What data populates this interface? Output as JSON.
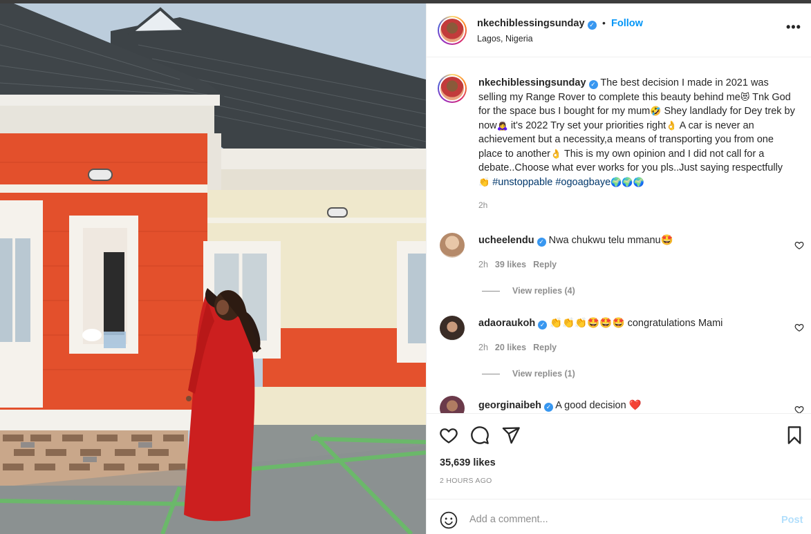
{
  "post": {
    "username": "nkechiblessingsunday",
    "verified_mark": "✓",
    "separator": "•",
    "follow_label": "Follow",
    "location": "Lagos, Nigeria",
    "more_label": "•••"
  },
  "caption": {
    "username": "nkechiblessingsunday",
    "text_1": "The best decision I made in 2021 was selling my Range Rover to complete this beauty behind me",
    "emoji_1": "😻",
    "text_2": " Tnk God for the space bus I bought for my mum",
    "emoji_2": "🤣",
    "text_3": " Shey landlady for Dey trek by now",
    "emoji_3": "🙇‍♀️",
    "text_4": " it's 2022 Try set your priorities right",
    "emoji_4": "👌",
    "text_5": " A car is never an achievement but a necessity,a means of transporting you from one place to another",
    "emoji_5": "👌",
    "text_6": " This is my own opinion and I did not call for a debate..Choose what ever works for you pls..Just saying respectfully ",
    "emoji_6": "👏",
    "hashtag_1": "#unstoppable",
    "hashtag_2": "#ogoagbaye",
    "emoji_7": "🌍🌍🌍",
    "time": "2h"
  },
  "comments": [
    {
      "username": "ucheelendu",
      "text": "Nwa chukwu telu mmanu🤩",
      "time": "2h",
      "likes": "39 likes",
      "reply_label": "Reply",
      "view_replies": "View replies (4)",
      "avatar_color": "#b58a6a"
    },
    {
      "username": "adaoraukoh",
      "text": "👏👏👏🤩🤩🤩 congratulations Mami",
      "time": "2h",
      "likes": "20 likes",
      "reply_label": "Reply",
      "view_replies": "View replies (1)",
      "avatar_color": "#3a2c26"
    },
    {
      "username": "georginaibeh",
      "text": "A good decision ❤️",
      "avatar_color": "#6b3a4a"
    }
  ],
  "actions": {
    "likes": "35,639 likes",
    "time_ago": "2 HOURS AGO"
  },
  "add_comment": {
    "placeholder": "Add a comment...",
    "post_label": "Post"
  },
  "colors": {
    "link": "#0095f6",
    "hashtag": "#00376b",
    "muted": "#8e8e8e",
    "post_disabled": "#b2dffc"
  }
}
